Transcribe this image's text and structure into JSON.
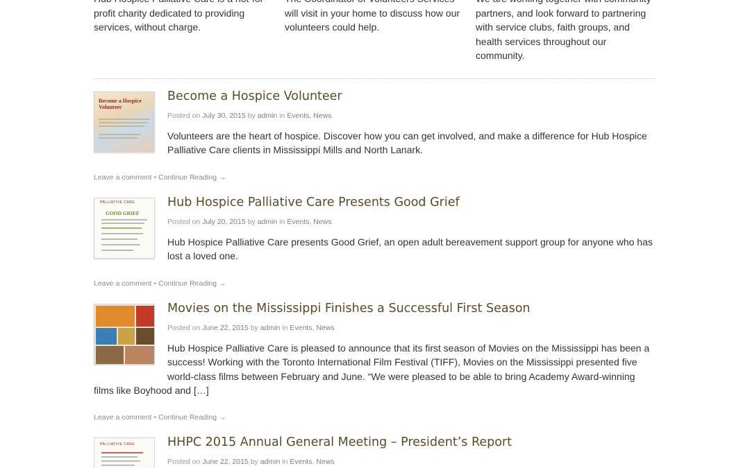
{
  "top_columns": [
    {
      "text": "Hub Hospice Palliative Care is a not-for-profit charity dedicated to providing services, without charge."
    },
    {
      "text": "The Coordinator of Volunteers Services will visit in your home to discuss how our volunteers could help."
    },
    {
      "text": "We are working together with community partners, and look forward to partnering with service clubs, faith groups, and health services throughout our community."
    }
  ],
  "labels": {
    "posted_on": "Posted on",
    "by": "by",
    "in": "in",
    "leave_comment": "Leave a comment",
    "separator": "•",
    "continue_reading": "Continue Reading →"
  },
  "posts": [
    {
      "title": "Become a Hospice Volunteer",
      "date": "July 30, 2015",
      "author": "admin",
      "categories": [
        "Events",
        "News"
      ],
      "excerpt": "Volunteers are the heart of hospice. Discover how you can get involved, and make a difference for Hub Hospice Palliative Care clients in Mississippi Mills and North Lanark.",
      "thumb_text": "Become a Hospice Volunteer"
    },
    {
      "title": "Hub Hospice Palliative Care Presents Good Grief",
      "date": "July 20, 2015",
      "author": "admin",
      "categories": [
        "Events",
        "News"
      ],
      "excerpt": "Hub Hospice Palliative Care presents Good Grief, an open adult bereavement support group for anyone who has lost a loved one.",
      "thumb_text": "GOOD GRIEF",
      "thumb_header": "PALLIATIVE CARE"
    },
    {
      "title": "Movies on the Mississippi Finishes a Successful First Season",
      "date": "June 22, 2015",
      "author": "admin",
      "categories": [
        "Events",
        "News"
      ],
      "excerpt": "Hub Hospice Palliative Care is pleased to announce that its first season of Movies on the Mississippi has been a success! Working with the Toronto International Film Festival (TIFF), Movies on the Mississippi presented five world-class films between February and June. “We were pleased to be able to bring Academy Award-winning films like Boyhood and […]"
    },
    {
      "title": "HHPC 2015 Annual General Meeting – President’s Report",
      "date": "June 22, 2015",
      "author": "admin",
      "categories": [
        "Events",
        "News"
      ],
      "thumb_header": "PALLIATIVE CARE"
    }
  ]
}
